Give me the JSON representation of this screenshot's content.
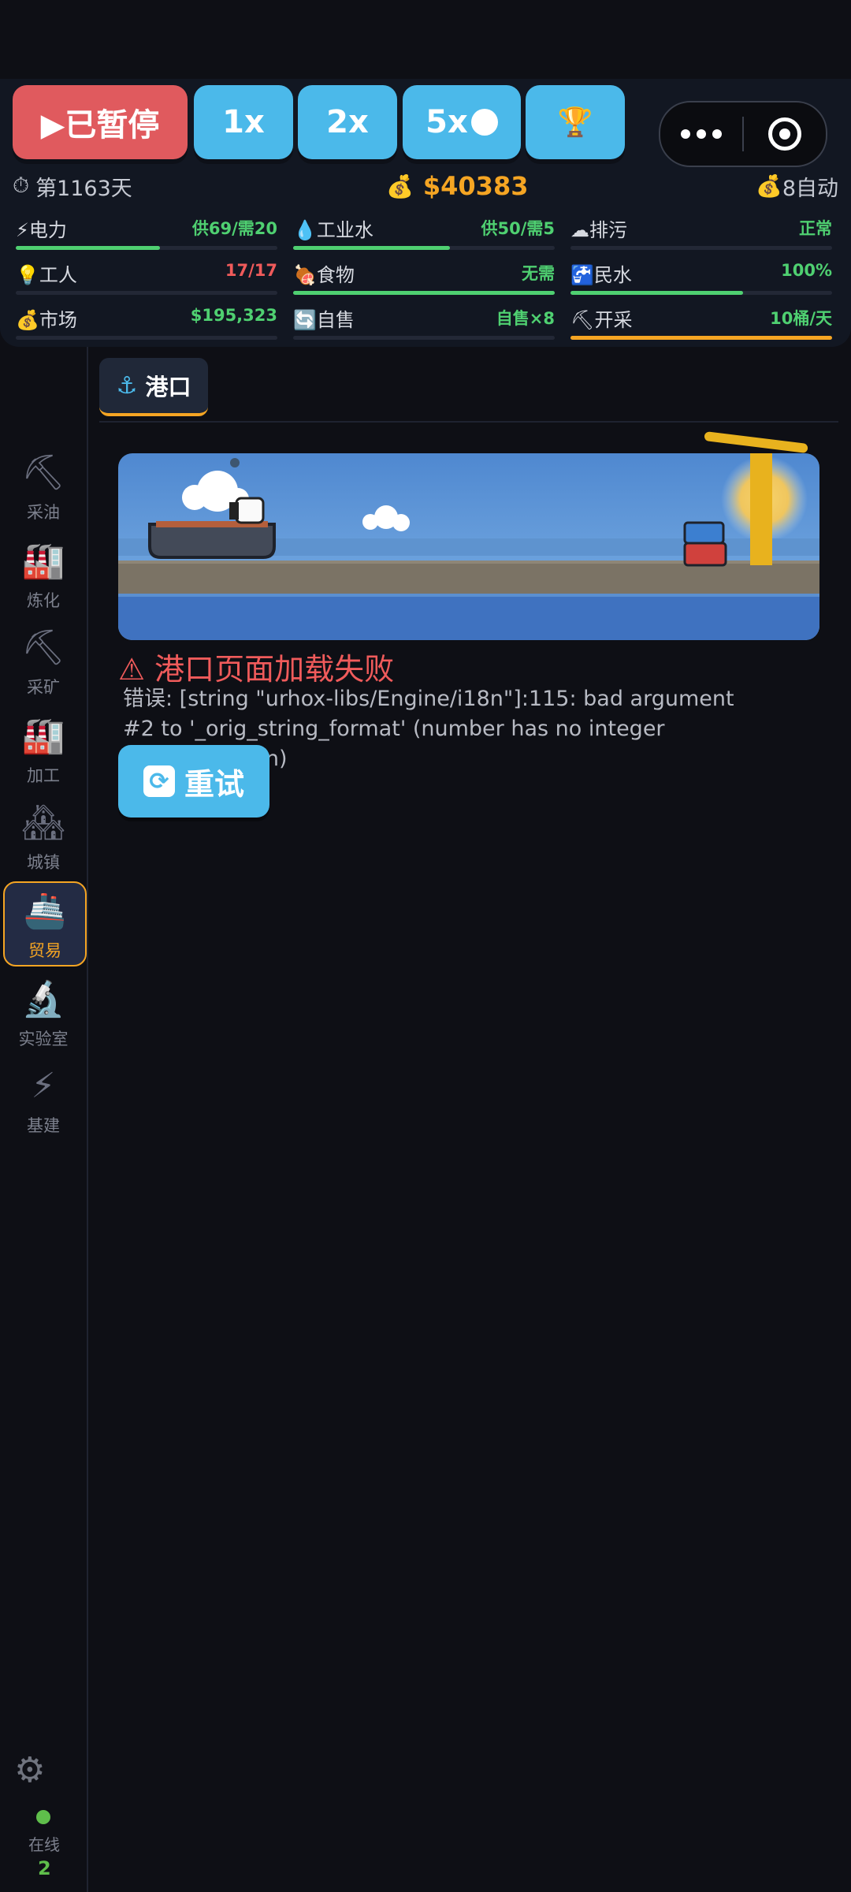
{
  "controls": {
    "pause_label": "▶已暂停",
    "speed_1": "1x",
    "speed_2": "2x",
    "speed_5": "5x",
    "trophy_icon": "🏆"
  },
  "status": {
    "day_icon": "⏱",
    "day": "第1163天",
    "money_icon": "💰",
    "money": "$40383",
    "auto_icon": "💰",
    "auto": "8自动"
  },
  "stats": [
    {
      "icon": "⚡",
      "label": "电力",
      "value": "供69/需20",
      "value_color": "green",
      "progress": 0.55,
      "bar_color": "g"
    },
    {
      "icon": "💧",
      "label": "工业水",
      "value": "供50/需5",
      "value_color": "green",
      "progress": 0.6,
      "bar_color": "g"
    },
    {
      "icon": "☁",
      "label": "排污",
      "value": "正常",
      "value_color": "green",
      "progress": 0,
      "bar_color": "g"
    },
    {
      "icon": "💡",
      "label": "工人",
      "value": "17/17",
      "value_color": "red",
      "progress": 0,
      "bar_color": "g"
    },
    {
      "icon": "🍖",
      "label": "食物",
      "value": "无需",
      "value_color": "green",
      "progress": 1,
      "bar_color": "g"
    },
    {
      "icon": "🚰",
      "label": "民水",
      "value": "100%",
      "value_color": "green",
      "progress": 0.66,
      "bar_color": "g"
    },
    {
      "icon": "💰",
      "label": "市场",
      "value": "$195,323",
      "value_color": "green",
      "progress": 0,
      "bar_color": "g"
    },
    {
      "icon": "🔄",
      "label": "自售",
      "value": "自售×8",
      "value_color": "green",
      "progress": 0,
      "bar_color": "g"
    },
    {
      "icon": "⛏",
      "label": "开采",
      "value": "10桶/天",
      "value_color": "green",
      "progress": 1,
      "bar_color": "o"
    }
  ],
  "sidebar": [
    {
      "icon": "⛏",
      "label": "采油"
    },
    {
      "icon": "🏭",
      "label": "炼化"
    },
    {
      "icon": "⛏",
      "label": "采矿"
    },
    {
      "icon": "🏭",
      "label": "加工"
    },
    {
      "icon": "🏘",
      "label": "城镇"
    },
    {
      "icon": "🚢",
      "label": "贸易",
      "active": true
    },
    {
      "icon": "🔬",
      "label": "实验室"
    },
    {
      "icon": "⚡",
      "label": "基建"
    }
  ],
  "footer": {
    "gear_icon": "⚙",
    "online_label": "在线",
    "online_count": "2"
  },
  "tab": {
    "anchor_icon": "⚓",
    "label": "港口"
  },
  "error": {
    "title": "⚠ 港口页面加载失败",
    "message": "错误: [string \"urhox-libs/Engine/i18n\"]:115: bad argument #2 to '_orig_string_format' (number has no integer representation)",
    "retry_label": "重试",
    "retry_icon": "🔄"
  }
}
